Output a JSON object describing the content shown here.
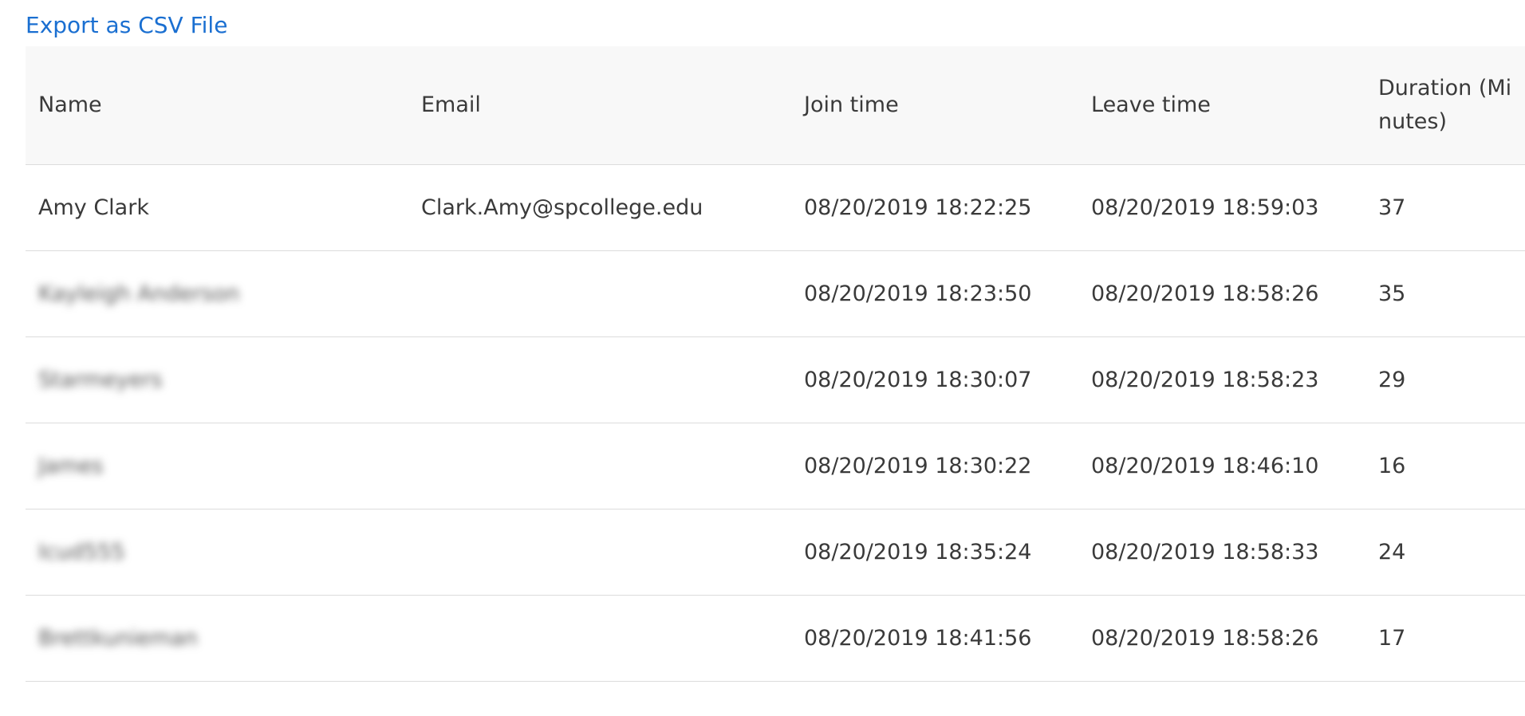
{
  "export_link": "Export as CSV File",
  "table": {
    "headers": {
      "name": "Name",
      "email": "Email",
      "join_time": "Join time",
      "leave_time": "Leave time",
      "duration": "Duration (Minutes)"
    },
    "rows": [
      {
        "name": "Amy Clark",
        "email": "Clark.Amy@spcollege.edu",
        "join": "08/20/2019 18:22:25",
        "leave": "08/20/2019 18:59:03",
        "duration": "37"
      },
      {
        "name": "Kayleigh Anderson",
        "email": "",
        "join": "08/20/2019 18:23:50",
        "leave": "08/20/2019 18:58:26",
        "duration": "35"
      },
      {
        "name": "Starmeyers",
        "email": "",
        "join": "08/20/2019 18:30:07",
        "leave": "08/20/2019 18:58:23",
        "duration": "29"
      },
      {
        "name": "James",
        "email": "",
        "join": "08/20/2019 18:30:22",
        "leave": "08/20/2019 18:46:10",
        "duration": "16"
      },
      {
        "name": "Icud555",
        "email": "",
        "join": "08/20/2019 18:35:24",
        "leave": "08/20/2019 18:58:33",
        "duration": "24"
      },
      {
        "name": "Brettkunieman",
        "email": "",
        "join": "08/20/2019 18:41:56",
        "leave": "08/20/2019 18:58:26",
        "duration": "17"
      }
    ]
  }
}
